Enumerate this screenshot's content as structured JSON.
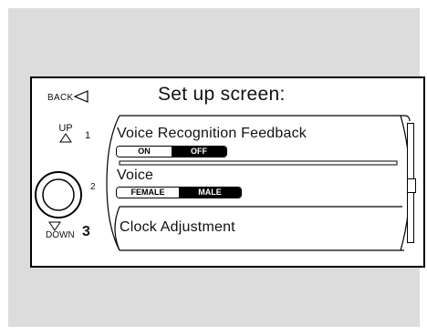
{
  "screen": {
    "title": "Set up screen:",
    "back_label": "BACK"
  },
  "controls": {
    "up_label": "UP",
    "down_label": "DOWN",
    "position_numbers": [
      "1",
      "2",
      "3"
    ]
  },
  "items": [
    {
      "label": "Voice Recognition Feedback",
      "options": [
        "ON",
        "OFF"
      ],
      "selected": "OFF"
    },
    {
      "label": "Voice",
      "options": [
        "FEMALE",
        "MALE"
      ],
      "selected": "MALE"
    },
    {
      "label": "Clock Adjustment"
    }
  ],
  "colors": {
    "panel_background": "#dcdcdc",
    "selected_option": "#000000"
  },
  "icons": {
    "back": "back-triangle-icon",
    "up": "up-triangle-icon",
    "down": "down-triangle-icon",
    "knob": "selector-knob-icon"
  }
}
